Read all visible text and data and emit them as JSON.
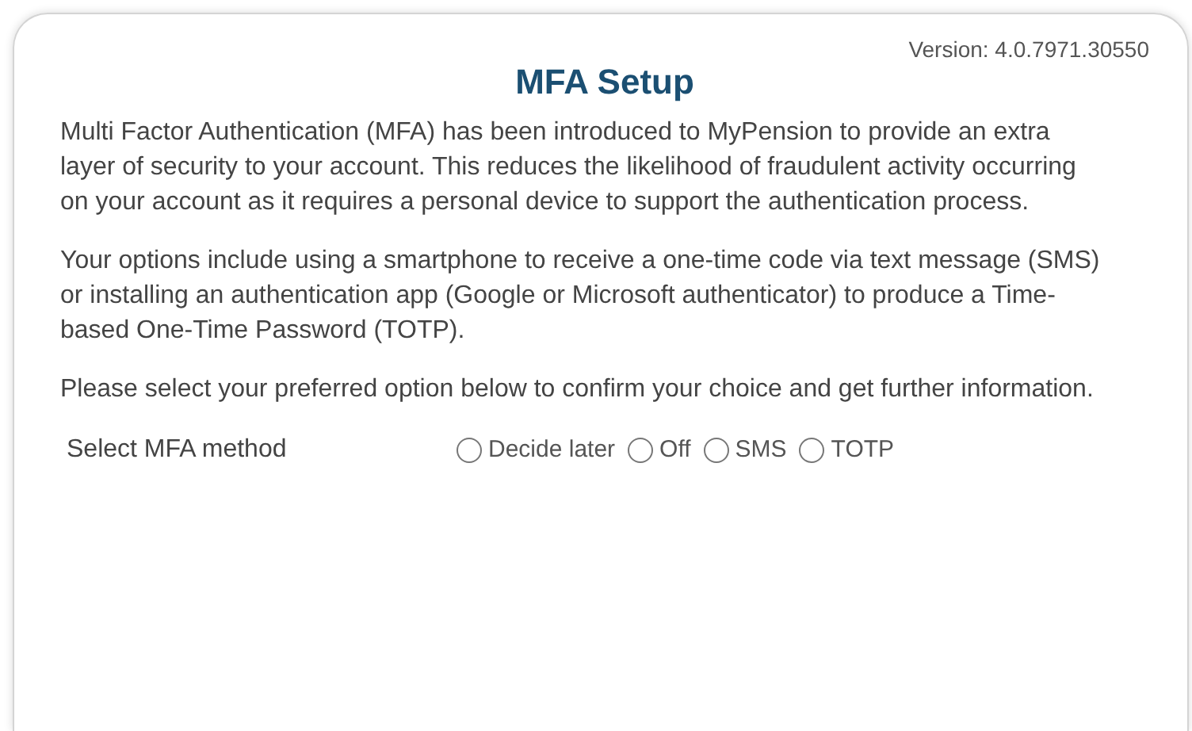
{
  "version": "Version: 4.0.7971.30550",
  "title": "MFA Setup",
  "paragraphs": [
    "Multi Factor Authentication (MFA) has been introduced to MyPension to provide an extra layer of security to your account. This reduces the likelihood of fraudulent activity occurring on your account as it requires a personal device to support the authentication process.",
    "Your options include using a smartphone to receive a one-time code via text message (SMS) or installing an authentication app (Google or Microsoft authenticator) to produce a Time-based One-Time Password (TOTP).",
    "Please select your preferred option below to confirm your choice and get further information."
  ],
  "method": {
    "label": "Select MFA method",
    "options": [
      {
        "label": "Decide later",
        "selected": false
      },
      {
        "label": "Off",
        "selected": false
      },
      {
        "label": "SMS",
        "selected": false
      },
      {
        "label": "TOTP",
        "selected": false
      }
    ]
  }
}
